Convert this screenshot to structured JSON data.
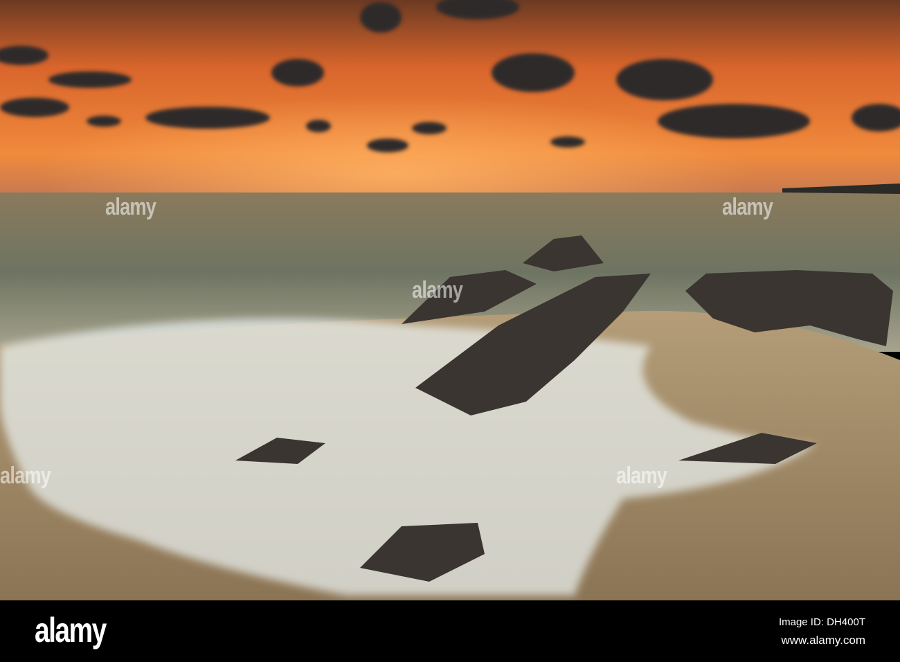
{
  "watermark": {
    "text": "alamy"
  },
  "footer": {
    "logo": "alamy",
    "image_id": "Image ID: DH400T",
    "website": "www.alamy.com"
  }
}
